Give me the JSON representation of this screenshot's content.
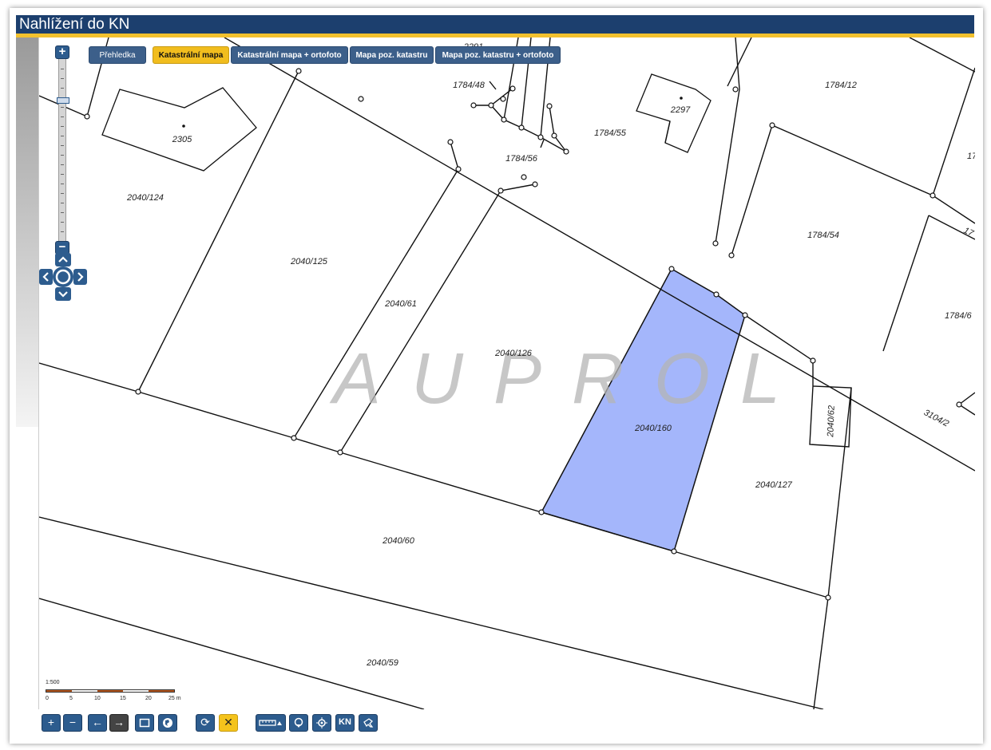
{
  "app": {
    "title": "Nahlížení do KN"
  },
  "tabs": [
    {
      "label": "Přehledka"
    },
    {
      "label": "Katastrální mapa"
    },
    {
      "label": "Katastrální mapa + ortofoto"
    },
    {
      "label": "Mapa poz. katastru"
    },
    {
      "label": "Mapa poz. katastru + ortofoto"
    }
  ],
  "active_tab": "Katastrální mapa",
  "zoom": {
    "in_label": "+",
    "out_label": "−"
  },
  "watermark": "AUPROL",
  "parcels": {
    "p2305": "2305",
    "p2297": "2297",
    "p1784_48": "1784/48",
    "p1784_55": "1784/55",
    "p1784_56": "1784/56",
    "p1784_12": "1784/12",
    "p1784_54": "1784/54",
    "p1784_6x": "1784/6",
    "p17a": "17",
    "p17b": "17",
    "p2040_124": "2040/124",
    "p2040_125": "2040/125",
    "p2040_61": "2040/61",
    "p2040_126": "2040/126",
    "p2040_160": "2040/160",
    "p2040_62": "2040/62",
    "p3104_2": "3104/2",
    "p2040_127": "2040/127",
    "p2040_60": "2040/60",
    "p2040_59": "2040/59",
    "p_top": "2291"
  },
  "selected_parcel_color": "#a4b6fb",
  "scale": {
    "ratio": "1:500",
    "ticks": [
      "0",
      "5",
      "10",
      "15",
      "20",
      "25 m"
    ]
  },
  "toolbar": {
    "kn_label": "KN"
  }
}
